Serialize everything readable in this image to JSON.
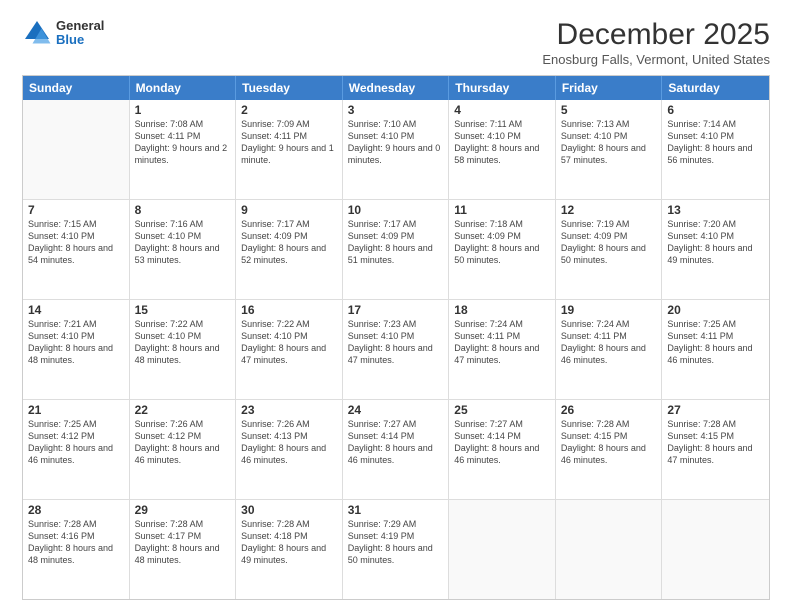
{
  "header": {
    "logo": {
      "general": "General",
      "blue": "Blue"
    },
    "title": "December 2025",
    "location": "Enosburg Falls, Vermont, United States"
  },
  "days_of_week": [
    "Sunday",
    "Monday",
    "Tuesday",
    "Wednesday",
    "Thursday",
    "Friday",
    "Saturday"
  ],
  "weeks": [
    [
      {
        "day": "",
        "empty": true
      },
      {
        "day": "1",
        "sunrise": "7:08 AM",
        "sunset": "4:11 PM",
        "daylight": "9 hours and 2 minutes."
      },
      {
        "day": "2",
        "sunrise": "7:09 AM",
        "sunset": "4:11 PM",
        "daylight": "9 hours and 1 minute."
      },
      {
        "day": "3",
        "sunrise": "7:10 AM",
        "sunset": "4:10 PM",
        "daylight": "9 hours and 0 minutes."
      },
      {
        "day": "4",
        "sunrise": "7:11 AM",
        "sunset": "4:10 PM",
        "daylight": "8 hours and 58 minutes."
      },
      {
        "day": "5",
        "sunrise": "7:13 AM",
        "sunset": "4:10 PM",
        "daylight": "8 hours and 57 minutes."
      },
      {
        "day": "6",
        "sunrise": "7:14 AM",
        "sunset": "4:10 PM",
        "daylight": "8 hours and 56 minutes."
      }
    ],
    [
      {
        "day": "7",
        "sunrise": "7:15 AM",
        "sunset": "4:10 PM",
        "daylight": "8 hours and 54 minutes."
      },
      {
        "day": "8",
        "sunrise": "7:16 AM",
        "sunset": "4:10 PM",
        "daylight": "8 hours and 53 minutes."
      },
      {
        "day": "9",
        "sunrise": "7:17 AM",
        "sunset": "4:09 PM",
        "daylight": "8 hours and 52 minutes."
      },
      {
        "day": "10",
        "sunrise": "7:17 AM",
        "sunset": "4:09 PM",
        "daylight": "8 hours and 51 minutes."
      },
      {
        "day": "11",
        "sunrise": "7:18 AM",
        "sunset": "4:09 PM",
        "daylight": "8 hours and 50 minutes."
      },
      {
        "day": "12",
        "sunrise": "7:19 AM",
        "sunset": "4:09 PM",
        "daylight": "8 hours and 50 minutes."
      },
      {
        "day": "13",
        "sunrise": "7:20 AM",
        "sunset": "4:10 PM",
        "daylight": "8 hours and 49 minutes."
      }
    ],
    [
      {
        "day": "14",
        "sunrise": "7:21 AM",
        "sunset": "4:10 PM",
        "daylight": "8 hours and 48 minutes."
      },
      {
        "day": "15",
        "sunrise": "7:22 AM",
        "sunset": "4:10 PM",
        "daylight": "8 hours and 48 minutes."
      },
      {
        "day": "16",
        "sunrise": "7:22 AM",
        "sunset": "4:10 PM",
        "daylight": "8 hours and 47 minutes."
      },
      {
        "day": "17",
        "sunrise": "7:23 AM",
        "sunset": "4:10 PM",
        "daylight": "8 hours and 47 minutes."
      },
      {
        "day": "18",
        "sunrise": "7:24 AM",
        "sunset": "4:11 PM",
        "daylight": "8 hours and 47 minutes."
      },
      {
        "day": "19",
        "sunrise": "7:24 AM",
        "sunset": "4:11 PM",
        "daylight": "8 hours and 46 minutes."
      },
      {
        "day": "20",
        "sunrise": "7:25 AM",
        "sunset": "4:11 PM",
        "daylight": "8 hours and 46 minutes."
      }
    ],
    [
      {
        "day": "21",
        "sunrise": "7:25 AM",
        "sunset": "4:12 PM",
        "daylight": "8 hours and 46 minutes."
      },
      {
        "day": "22",
        "sunrise": "7:26 AM",
        "sunset": "4:12 PM",
        "daylight": "8 hours and 46 minutes."
      },
      {
        "day": "23",
        "sunrise": "7:26 AM",
        "sunset": "4:13 PM",
        "daylight": "8 hours and 46 minutes."
      },
      {
        "day": "24",
        "sunrise": "7:27 AM",
        "sunset": "4:14 PM",
        "daylight": "8 hours and 46 minutes."
      },
      {
        "day": "25",
        "sunrise": "7:27 AM",
        "sunset": "4:14 PM",
        "daylight": "8 hours and 46 minutes."
      },
      {
        "day": "26",
        "sunrise": "7:28 AM",
        "sunset": "4:15 PM",
        "daylight": "8 hours and 46 minutes."
      },
      {
        "day": "27",
        "sunrise": "7:28 AM",
        "sunset": "4:15 PM",
        "daylight": "8 hours and 47 minutes."
      }
    ],
    [
      {
        "day": "28",
        "sunrise": "7:28 AM",
        "sunset": "4:16 PM",
        "daylight": "8 hours and 48 minutes."
      },
      {
        "day": "29",
        "sunrise": "7:28 AM",
        "sunset": "4:17 PM",
        "daylight": "8 hours and 48 minutes."
      },
      {
        "day": "30",
        "sunrise": "7:28 AM",
        "sunset": "4:18 PM",
        "daylight": "8 hours and 49 minutes."
      },
      {
        "day": "31",
        "sunrise": "7:29 AM",
        "sunset": "4:19 PM",
        "daylight": "8 hours and 50 minutes."
      },
      {
        "day": "",
        "empty": true
      },
      {
        "day": "",
        "empty": true
      },
      {
        "day": "",
        "empty": true
      }
    ]
  ],
  "labels": {
    "sunrise_prefix": "Sunrise: ",
    "sunset_prefix": "Sunset: ",
    "daylight_prefix": "Daylight: "
  }
}
